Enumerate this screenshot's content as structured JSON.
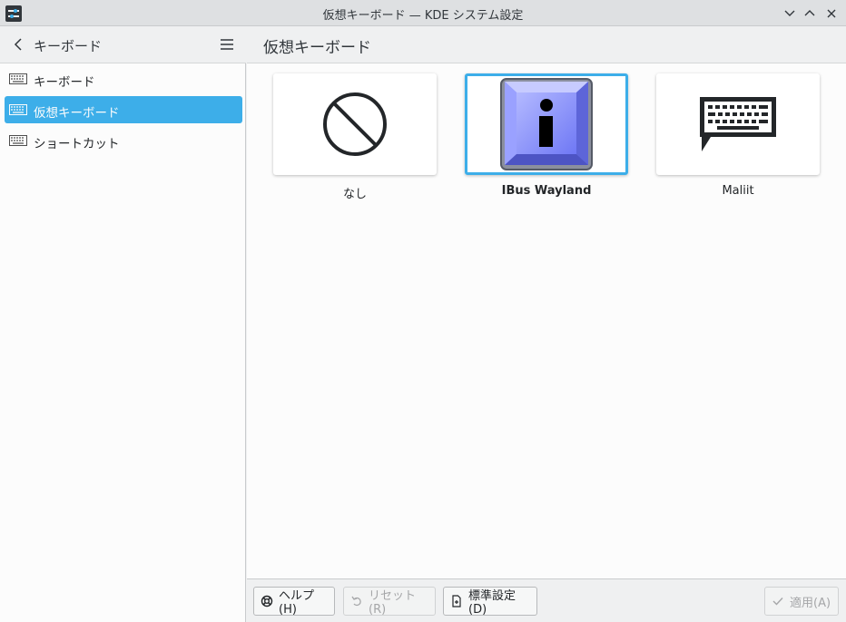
{
  "window": {
    "title": "仮想キーボード — KDE システム設定",
    "app_icon": "settings-sliders-icon",
    "controls": [
      "chevron-down-icon",
      "chevron-up-icon",
      "close-icon"
    ]
  },
  "sidebar": {
    "title": "キーボード",
    "items": [
      {
        "label": "キーボード",
        "icon": "keyboard-icon",
        "active": false
      },
      {
        "label": "仮想キーボード",
        "icon": "keyboard-icon",
        "active": true
      },
      {
        "label": "ショートカット",
        "icon": "keyboard-icon",
        "active": false
      }
    ]
  },
  "main": {
    "title": "仮想キーボード",
    "options": [
      {
        "label": "なし",
        "icon": "none-prohibited-icon",
        "selected": false
      },
      {
        "label": "IBus Wayland",
        "icon": "ibus-info-icon",
        "selected": true
      },
      {
        "label": "Maliit",
        "icon": "keyboard-speech-icon",
        "selected": false
      }
    ]
  },
  "footer": {
    "help_label": "ヘルプ(H)",
    "reset_label": "リセット(R)",
    "defaults_label": "標準設定(D)",
    "apply_label": "適用(A)"
  },
  "colors": {
    "accent": "#3daee9",
    "background": "#eff0f1",
    "view": "#fcfcfc",
    "text": "#232629"
  }
}
